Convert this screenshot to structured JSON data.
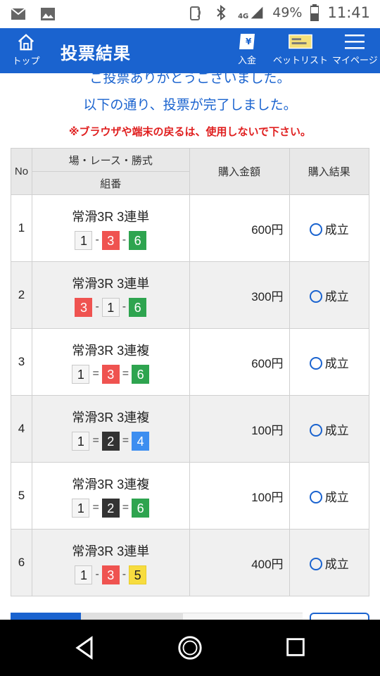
{
  "status_bar": {
    "carrier_icon": "au-carrier-icon",
    "network_label": "4G",
    "battery": "49%",
    "time": "11:41"
  },
  "header": {
    "home_label": "トップ",
    "title": "投票結果",
    "deposit_label": "入金",
    "betlist_label": "ベットリスト",
    "mypage_label": "マイページ",
    "accent": "#1a63cf"
  },
  "message": {
    "line1": "ご投票ありがとうございました。",
    "line2": "以下の通り、投票が完了しました。",
    "warning": "※ブラウザや端末の戻るは、使用しないで下さい。"
  },
  "table": {
    "headers": {
      "no": "No",
      "race": "場・レース・勝式",
      "combination": "組番",
      "amount": "購入金額",
      "result": "購入結果"
    },
    "rows": [
      {
        "no": "1",
        "race": "常滑3R 3連単",
        "combo": [
          "1",
          "3",
          "6"
        ],
        "colors": [
          "white",
          "red",
          "green"
        ],
        "sep": "-",
        "amount": "600円",
        "result": "成立"
      },
      {
        "no": "2",
        "race": "常滑3R 3連単",
        "combo": [
          "3",
          "1",
          "6"
        ],
        "colors": [
          "red",
          "white",
          "green"
        ],
        "sep": "-",
        "amount": "300円",
        "result": "成立"
      },
      {
        "no": "3",
        "race": "常滑3R 3連複",
        "combo": [
          "1",
          "3",
          "6"
        ],
        "colors": [
          "white",
          "red",
          "green"
        ],
        "sep": "=",
        "amount": "600円",
        "result": "成立"
      },
      {
        "no": "4",
        "race": "常滑3R 3連複",
        "combo": [
          "1",
          "2",
          "4"
        ],
        "colors": [
          "white",
          "black",
          "blue"
        ],
        "sep": "=",
        "amount": "100円",
        "result": "成立"
      },
      {
        "no": "5",
        "race": "常滑3R 3連複",
        "combo": [
          "1",
          "2",
          "6"
        ],
        "colors": [
          "white",
          "black",
          "green"
        ],
        "sep": "=",
        "amount": "100円",
        "result": "成立"
      },
      {
        "no": "6",
        "race": "常滑3R 3連単",
        "combo": [
          "1",
          "3",
          "5"
        ],
        "colors": [
          "white",
          "red",
          "yellow"
        ],
        "sep": "-",
        "amount": "400円",
        "result": "成立"
      }
    ]
  }
}
